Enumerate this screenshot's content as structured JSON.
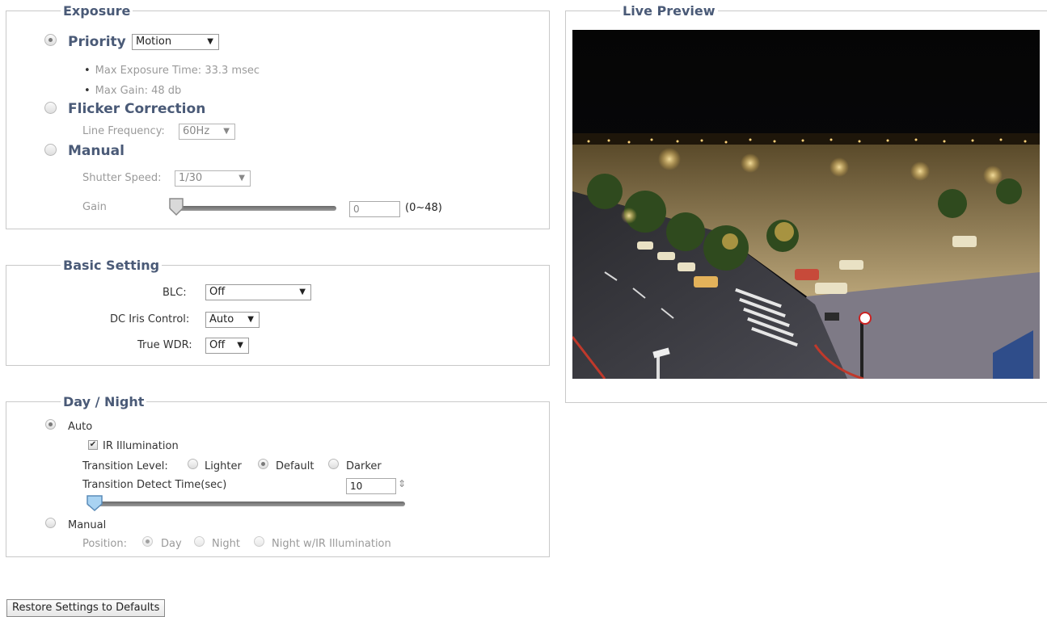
{
  "exposure": {
    "legend": "Exposure",
    "priority": {
      "label": "Priority",
      "selected": true,
      "value": "Motion"
    },
    "bullets": [
      "Max Exposure Time: 33.3 msec",
      "Max Gain: 48 db"
    ],
    "flicker": {
      "label": "Flicker Correction",
      "selected": false,
      "line_freq_label": "Line Frequency:",
      "line_freq_value": "60Hz"
    },
    "manual": {
      "label": "Manual",
      "selected": false,
      "shutter_label": "Shutter Speed:",
      "shutter_value": "1/30",
      "gain_label": "Gain",
      "gain_value": "0",
      "gain_range": "(0~48)",
      "gain_level": 0
    }
  },
  "basic": {
    "legend": "Basic Setting",
    "blc_label": "BLC:",
    "blc_value": "Off",
    "dciris_label": "DC Iris Control:",
    "dciris_value": "Auto",
    "wdr_label": "True WDR:",
    "wdr_value": "Off"
  },
  "daynight": {
    "legend": "Day / Night",
    "auto": {
      "label": "Auto",
      "selected": true
    },
    "ir": {
      "label": "IR Illumination",
      "checked": true
    },
    "transition_label": "Transition Level:",
    "transition_options": [
      "Lighter",
      "Default",
      "Darker"
    ],
    "transition_selected": "Default",
    "detect_label": "Transition Detect Time(sec)",
    "detect_value": "10",
    "manual": {
      "label": "Manual",
      "selected": false
    },
    "position_label": "Position:",
    "position_options": [
      "Day",
      "Night",
      "Night w/IR Illumination"
    ],
    "position_selected": "Day"
  },
  "preview": {
    "legend": "Live Preview"
  },
  "restore_button": "Restore Settings to Defaults",
  "icons": {
    "dropdown": "▼",
    "spinner": "⇕",
    "check": "✔"
  },
  "colors": {
    "legend": "#4a5a77",
    "border": "#c9c9c9"
  }
}
